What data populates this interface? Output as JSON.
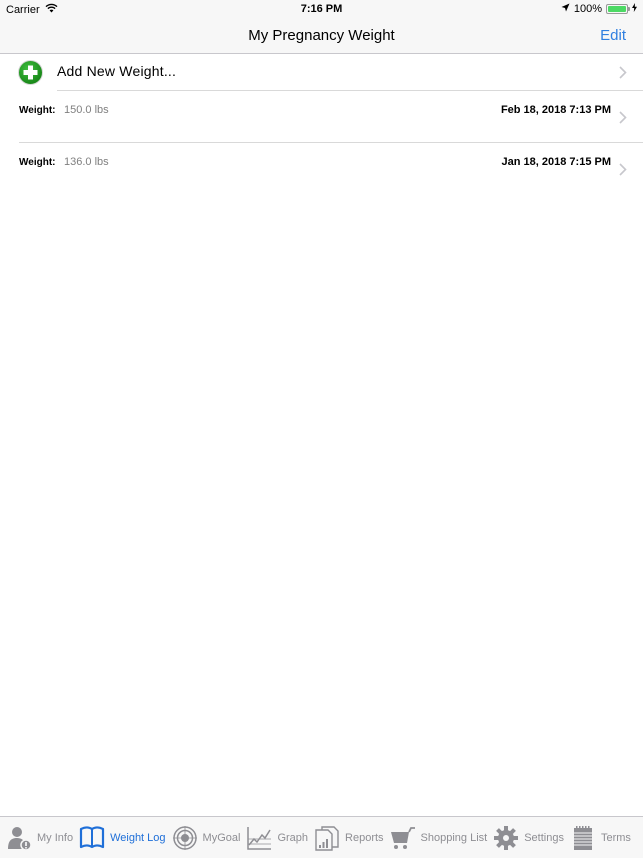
{
  "status_bar": {
    "carrier": "Carrier",
    "time": "7:16 PM",
    "battery_percent": "100%",
    "battery_level": 1.0,
    "icons": [
      "wifi-icon",
      "location-arrow-icon",
      "battery-icon",
      "charging-bolt-icon"
    ]
  },
  "nav": {
    "title": "My Pregnancy Weight",
    "edit_label": "Edit"
  },
  "list": {
    "add_label": "Add New Weight...",
    "entries": [
      {
        "label": "Weight:",
        "value": "150.0 lbs",
        "date": "Feb 18, 2018 7:13 PM"
      },
      {
        "label": "Weight:",
        "value": "136.0 lbs",
        "date": "Jan 18, 2018 7:15 PM"
      }
    ]
  },
  "tabs": [
    {
      "label": "My Info",
      "icon": "person-info-icon",
      "active": false
    },
    {
      "label": "Weight Log",
      "icon": "book-icon",
      "active": true
    },
    {
      "label": "MyGoal",
      "icon": "target-icon",
      "active": false
    },
    {
      "label": "Graph",
      "icon": "graph-icon",
      "active": false
    },
    {
      "label": "Reports",
      "icon": "reports-icon",
      "active": false
    },
    {
      "label": "Shopping List",
      "icon": "cart-icon",
      "active": false
    },
    {
      "label": "Settings",
      "icon": "gear-icon",
      "active": false
    },
    {
      "label": "Terms",
      "icon": "notepad-icon",
      "active": false
    }
  ],
  "colors": {
    "accent": "#1f6fd8",
    "edit": "#2f7fe0",
    "add_green": "#1a8a1a",
    "battery": "#4cd964",
    "inactive_tab": "#8e8e93"
  }
}
